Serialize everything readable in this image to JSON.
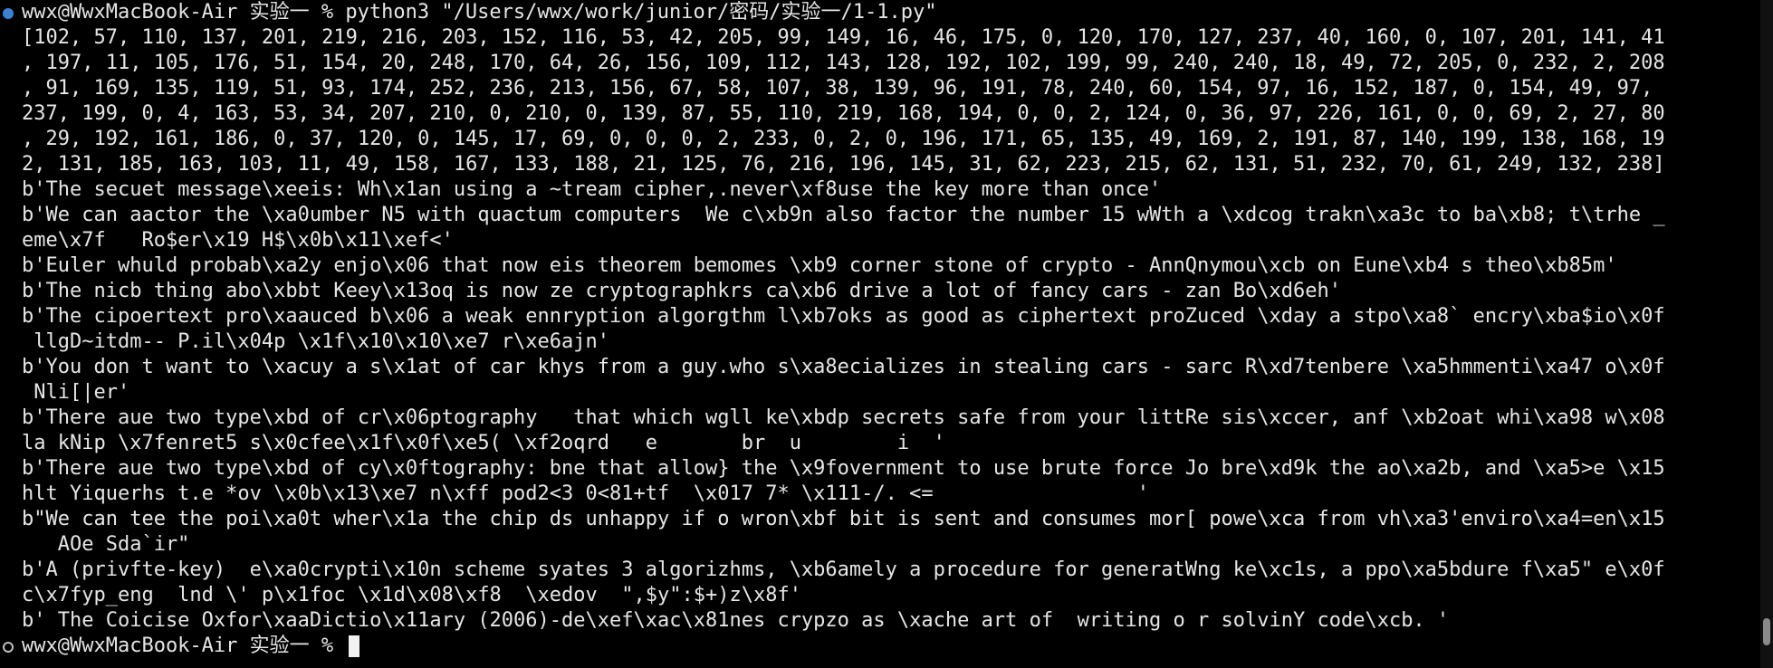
{
  "terminal": {
    "command_prompt": "wwx@WwxMacBook-Air 实验一 % python3 \"/Users/wwx/work/junior/密码/实验一/1-1.py\"",
    "output_lines": [
      "[102, 57, 110, 137, 201, 219, 216, 203, 152, 116, 53, 42, 205, 99, 149, 16, 46, 175, 0, 120, 170, 127, 237, 40, 160, 0, 107, 201, 141, 41",
      ", 197, 11, 105, 176, 51, 154, 20, 248, 170, 64, 26, 156, 109, 112, 143, 128, 192, 102, 199, 99, 240, 240, 18, 49, 72, 205, 0, 232, 2, 208",
      ", 91, 169, 135, 119, 51, 93, 174, 252, 236, 213, 156, 67, 58, 107, 38, 139, 96, 191, 78, 240, 60, 154, 97, 16, 152, 187, 0, 154, 49, 97,",
      "237, 199, 0, 4, 163, 53, 34, 207, 210, 0, 210, 0, 139, 87, 55, 110, 219, 168, 194, 0, 0, 2, 124, 0, 36, 97, 226, 161, 0, 0, 69, 2, 27, 80",
      ", 29, 192, 161, 186, 0, 37, 120, 0, 145, 17, 69, 0, 0, 0, 2, 233, 0, 2, 0, 196, 171, 65, 135, 49, 169, 2, 191, 87, 140, 199, 138, 168, 19",
      "2, 131, 185, 163, 103, 11, 49, 158, 167, 133, 188, 21, 125, 76, 216, 196, 145, 31, 62, 223, 215, 62, 131, 51, 232, 70, 61, 249, 132, 238]",
      "b'The secuet message\\xeeis: Wh\\x1an using a ~tream cipher,.never\\xf8use the key more than once'",
      "b'We can aactor the \\xa0umber N5 with quactum computers  We c\\xb9n also factor the number 15 wWth a \\xdcog trakn\\xa3c to ba\\xb8; t\\trhe _",
      "eme\\x7f   Ro$er\\x19 H$\\x0b\\x11\\xef<'",
      "b'Euler whuld probab\\xa2y enjo\\x06 that now eis theorem bemomes \\xb9 corner stone of crypto - AnnQnymou\\xcb on Eune\\xb4 s theo\\xb85m'",
      "b'The nicb thing abo\\xbbt Keey\\x13oq is now ze cryptographkrs ca\\xb6 drive a lot of fancy cars - zan Bo\\xd6eh'",
      "b'The cipoertext pro\\xaauced b\\x06 a weak ennryption algorgthm l\\xb7oks as good as ciphertext proZuced \\xday a stpo\\xa8` encry\\xba$io\\x0f",
      " llgD~itdm-- P.il\\x04p \\x1f\\x10\\x10\\xe7 r\\xe6ajn'",
      "b'You don t want to \\xacuy a s\\x1at of car khys from a guy.who s\\xa8ecializes in stealing cars - sarc R\\xd7tenbere \\xa5hmmenti\\xa47 o\\x0f",
      " Nli[|er'",
      "b'There aue two type\\xbd of cr\\x06ptography   that which wgll ke\\xbdp secrets safe from your littRe sis\\xccer, anf \\xb2oat whi\\xa98 w\\x08",
      "la kNip \\x7fenret5 s\\x0cfee\\x1f\\x0f\\xe5( \\xf2oqrd   e       br  u        i  '",
      "b'There aue two type\\xbd of cy\\x0ftography: bne that allow} the \\x9fovernment to use brute force Jo bre\\xd9k the ao\\xa2b, and \\xa5>e \\x15",
      "hlt Yiquerhs t.e *ov \\x0b\\x13\\xe7 n\\xff pod2<3 0<81+tf  \\x017 7* \\x111-/. <=                 '",
      "b\"We can tee the poi\\xa0t wher\\x1a the chip ds unhappy if o wron\\xbf bit is sent and consumes mor[ powe\\xca from vh\\xa3'enviro\\xa4=en\\x15",
      "   AOe Sda`ir\"",
      "b'A (privfte-key)  e\\xa0crypti\\x10n scheme syates 3 algorizhms, \\xb6amely a procedure for generatWng ke\\xc1s, a ppo\\xa5bdure f\\xa5\" e\\x0f",
      "c\\x7fyp_eng  lnd \\' p\\x1foc \\x1d\\x08\\xf8  \\xedov  \",$y\":$+)z\\x8f'",
      "b' The Coicise Oxfor\\xaaDictio\\x11ary (2006)-de\\xef\\xac\\x81nes crypzo as \\xache art of  writing o r solvinY code\\xcb. '"
    ],
    "final_prompt": "wwx@WwxMacBook-Air 实验一 % ",
    "colors": {
      "background": "#000000",
      "foreground": "#e6e6e6",
      "marker_blue": "#3b82d6",
      "marker_gray": "#bfbfbf",
      "cursor": "#f2f2f2"
    },
    "icons": [
      "command-status-marker-icon",
      "prompt-marker-icon",
      "cursor-block-icon"
    ]
  }
}
